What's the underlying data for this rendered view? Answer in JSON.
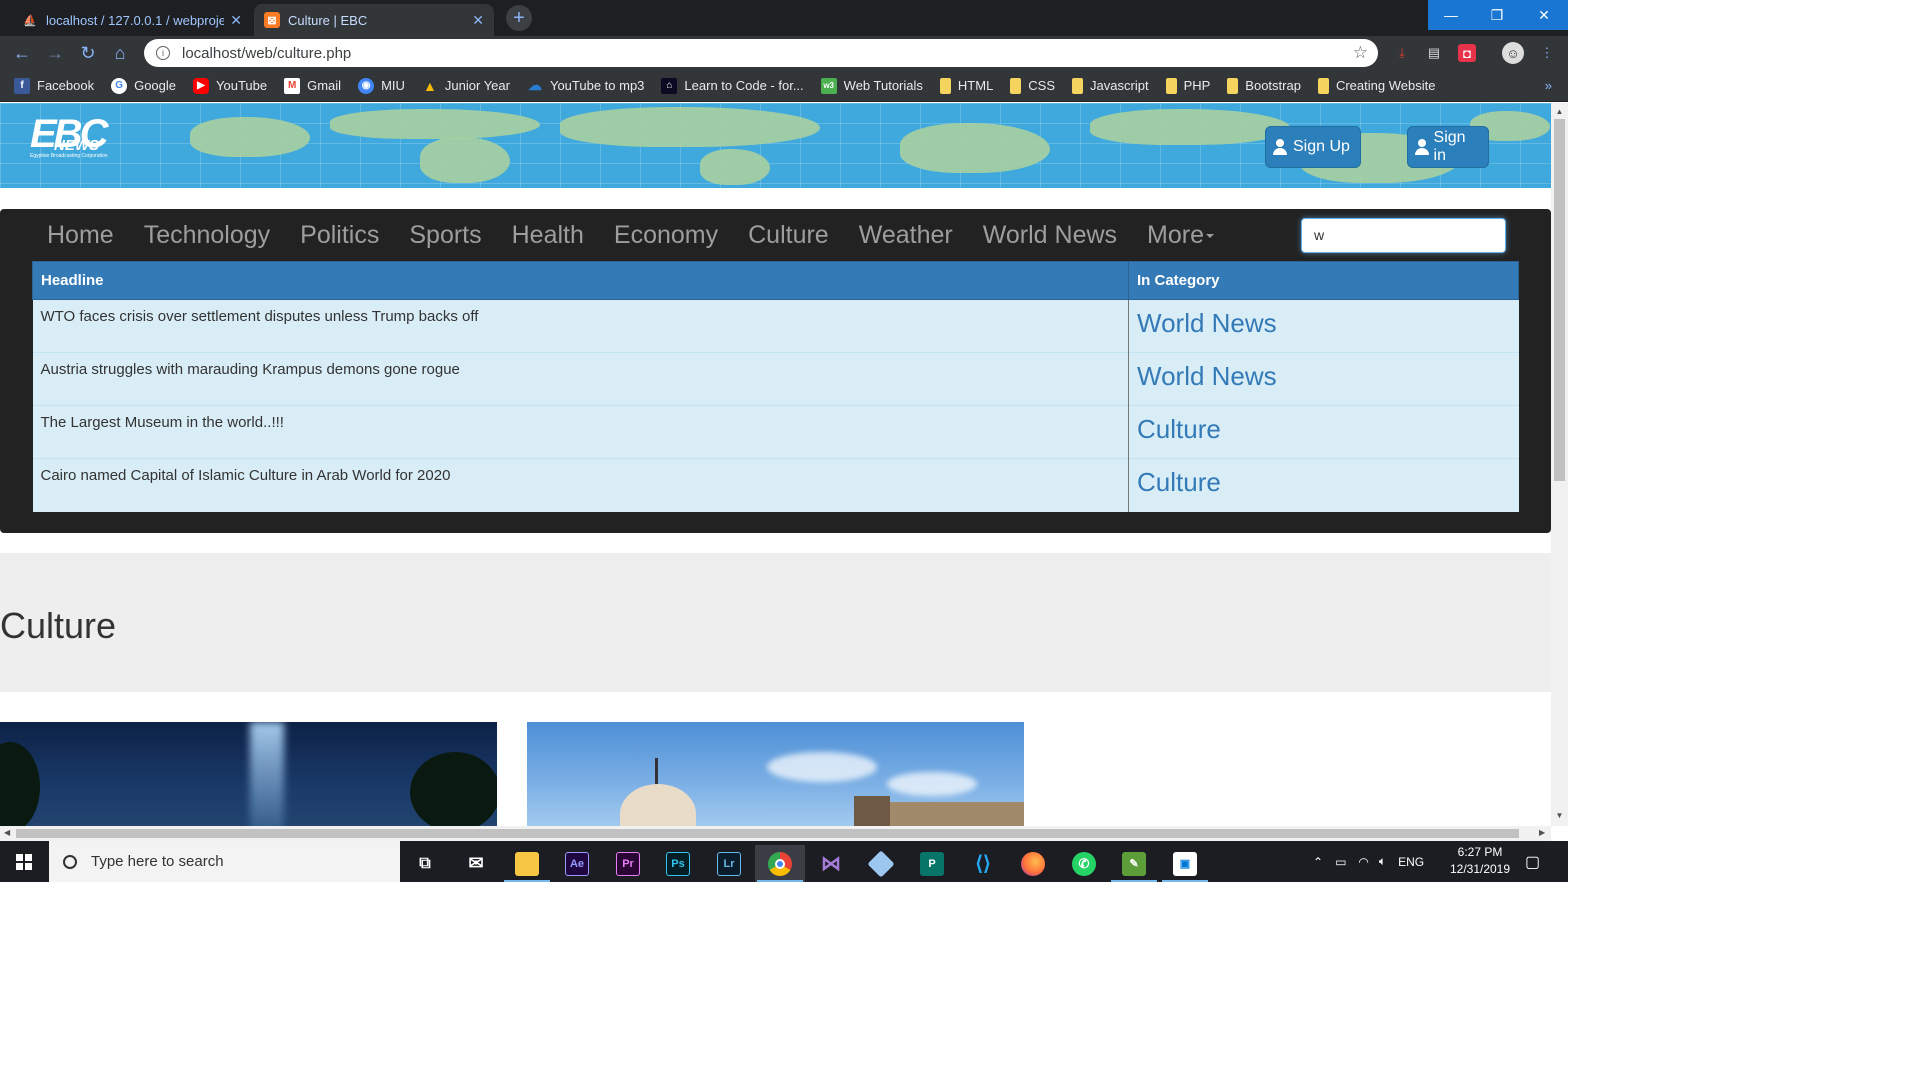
{
  "browser": {
    "tabs": [
      {
        "title": "localhost / 127.0.0.1 / webproject",
        "active": false
      },
      {
        "title": "Culture | EBC",
        "active": true
      }
    ],
    "url": "localhost/web/culture.php",
    "bookmarks": [
      {
        "label": "Facebook",
        "icon": "facebook-icon",
        "color": "#3b5998"
      },
      {
        "label": "Google",
        "icon": "google-icon",
        "color": "#ffffff"
      },
      {
        "label": "YouTube",
        "icon": "youtube-icon",
        "color": "#ff0000"
      },
      {
        "label": "Gmail",
        "icon": "gmail-icon",
        "color": "#ea4335"
      },
      {
        "label": "MIU",
        "icon": "globe-icon",
        "color": "#4285f4"
      },
      {
        "label": "Junior Year",
        "icon": "drive-icon",
        "color": "#0f9d58"
      },
      {
        "label": "YouTube to mp3",
        "icon": "cloud-icon",
        "color": "#2a7fd4"
      },
      {
        "label": "Learn to Code - for...",
        "icon": "code-icon",
        "color": "#0a0a23"
      },
      {
        "label": "Web Tutorials",
        "icon": "w3-icon",
        "color": "#4caf50"
      },
      {
        "label": "HTML",
        "icon": "folder-icon",
        "color": "#f4d35e"
      },
      {
        "label": "CSS",
        "icon": "folder-icon",
        "color": "#f4d35e"
      },
      {
        "label": "Javascript",
        "icon": "folder-icon",
        "color": "#f4d35e"
      },
      {
        "label": "PHP",
        "icon": "folder-icon",
        "color": "#f4d35e"
      },
      {
        "label": "Bootstrap",
        "icon": "folder-icon",
        "color": "#f4d35e"
      },
      {
        "label": "Creating Website",
        "icon": "folder-icon",
        "color": "#f4d35e"
      }
    ],
    "bookmarks_more": "»"
  },
  "site": {
    "logo_main": "EBC",
    "logo_sub": "NEWS",
    "logo_tag": "Egyptian Broadcasting Corporation",
    "signup_label": "Sign Up",
    "signin_label": "Sign in",
    "nav": [
      "Home",
      "Technology",
      "Politics",
      "Sports",
      "Health",
      "Economy",
      "Culture",
      "Weather",
      "World News",
      "More"
    ],
    "search_value": "w",
    "results": {
      "headers": {
        "headline": "Headline",
        "category": "In Category"
      },
      "rows": [
        {
          "headline": "WTO faces crisis over settlement disputes unless Trump backs off",
          "category": "World News"
        },
        {
          "headline": "Austria struggles with marauding Krampus demons gone rogue",
          "category": "World News"
        },
        {
          "headline": "The Largest Museum in the world..!!!",
          "category": "Culture"
        },
        {
          "headline": "Cairo named Capital of Islamic Culture in Arab World for 2020",
          "category": "Culture"
        }
      ]
    },
    "page_heading": "Culture"
  },
  "taskbar": {
    "search_placeholder": "Type here to search",
    "apps": [
      "task-view",
      "mail",
      "file-explorer",
      "after-effects",
      "premiere",
      "photoshop",
      "lightroom",
      "chrome",
      "visual-studio",
      "3d-viewer",
      "publisher",
      "vscode",
      "firefox",
      "whatsapp",
      "excel-photos",
      "photos"
    ],
    "app_labels": {
      "ae": "Ae",
      "pr": "Pr",
      "ps": "Ps",
      "lr": "Lr",
      "pub": "P"
    },
    "language": "ENG",
    "time": "6:27 PM",
    "date": "12/31/2019"
  },
  "colors": {
    "brand_blue": "#337ab7",
    "banner_blue": "#3fa9dd",
    "nav_dark": "#222222",
    "row_bg": "#d9edf7",
    "windows_accent": "#1976d2"
  }
}
